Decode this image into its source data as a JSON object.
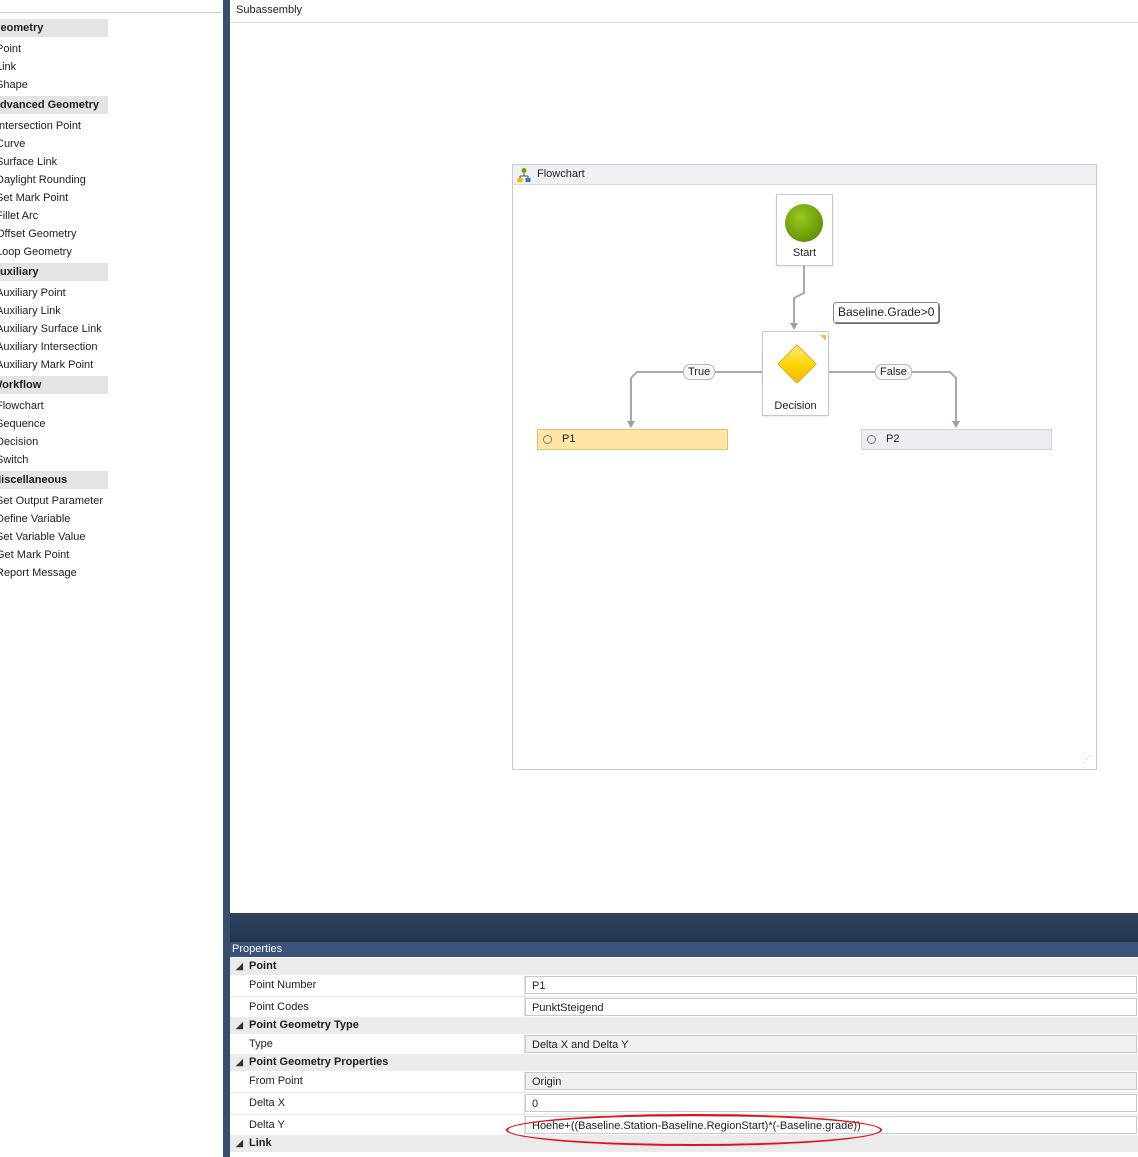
{
  "toolbox": {
    "categories": [
      {
        "label": "Geometry",
        "items": [
          "Point",
          "Link",
          "Shape"
        ]
      },
      {
        "label": "Advanced Geometry",
        "items": [
          "Intersection Point",
          "Curve",
          "Surface Link",
          "Daylight Rounding",
          "Set Mark Point",
          "Fillet Arc",
          "Offset Geometry",
          "Loop Geometry"
        ]
      },
      {
        "label": "Auxiliary",
        "items": [
          "Auxiliary Point",
          "Auxiliary Link",
          "Auxiliary Surface Link",
          "Auxiliary Intersection",
          "Auxiliary Mark Point"
        ]
      },
      {
        "label": "Workflow",
        "items": [
          "Flowchart",
          "Sequence",
          "Decision",
          "Switch"
        ]
      },
      {
        "label": "Miscellaneous",
        "items": [
          "Set Output Parameter",
          "Define Variable",
          "Set Variable Value",
          "Get Mark Point",
          "Report Message"
        ]
      }
    ]
  },
  "designer": {
    "title": "Subassembly",
    "flowchart": {
      "title": "Flowchart",
      "start_label": "Start",
      "decision_label": "Decision",
      "condition": "Baseline.Grade>0",
      "true_label": "True",
      "false_label": "False",
      "step_true": "P1",
      "step_false": "P2"
    }
  },
  "properties": {
    "title": "Properties",
    "cat_point": "Point",
    "point_number_label": "Point Number",
    "point_number_value": "P1",
    "point_codes_label": "Point Codes",
    "point_codes_value": "PunktSteigend",
    "cat_geometry_type": "Point Geometry Type",
    "type_label": "Type",
    "type_value": "Delta X and Delta Y",
    "cat_geometry_props": "Point Geometry Properties",
    "from_point_label": "From Point",
    "from_point_value": "Origin",
    "delta_x_label": "Delta X",
    "delta_x_value": "0",
    "delta_y_label": "Delta Y",
    "delta_y_value": "Hoehe+((Baseline.Station-Baseline.RegionStart)*(-Baseline.grade))",
    "cat_link": "Link"
  },
  "colors": {
    "highlight": "#e0111a",
    "selected_step": "#ffe6a8",
    "start": "#6fa10a",
    "decision": "#ffd400"
  }
}
